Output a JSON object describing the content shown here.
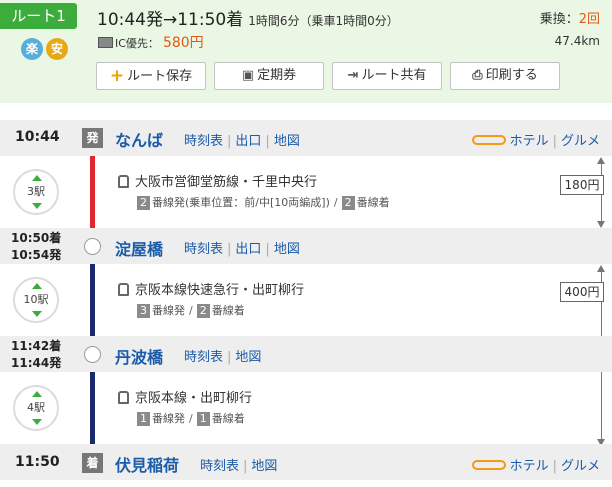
{
  "route": {
    "label": "ルート1",
    "badges": [
      "楽",
      "安"
    ],
    "times": "10:44発→11:50着",
    "duration": "1時間6分（乗車1時間0分）",
    "transfer_label": "乗換：",
    "transfer_count": "2回",
    "fare_mode": "IC優先：",
    "fare": "580円",
    "distance": "47.4km",
    "colors": {
      "accent": "#3cac3c",
      "fare": "#e05a10",
      "link": "#1b5ca8"
    }
  },
  "actions": {
    "save": "ルート保存",
    "pass": "定期券",
    "share": "ルート共有",
    "print": "印刷する"
  },
  "links": {
    "timetable": "時刻表",
    "exit": "出口",
    "map": "地図",
    "hotel": "ホテル",
    "gourmet": "グルメ"
  },
  "stations": [
    {
      "time": "10:44",
      "mark": "発",
      "name": "なんば"
    },
    {
      "arr": "10:50着",
      "dep": "10:54発",
      "name": "淀屋橋"
    },
    {
      "arr": "11:42着",
      "dep": "11:44発",
      "name": "丹波橋"
    },
    {
      "time": "11:50",
      "mark": "着",
      "name": "伏見稲荷"
    }
  ],
  "segments": [
    {
      "stops": "3駅",
      "line": "大阪市営御堂筋線・千里中央行",
      "dep_num": "2",
      "dep_text": "番線発(乗車位置：前/中[10両編成])",
      "arr_num": "2",
      "arr_text": "番線着",
      "fare": "180円",
      "rail_color": "#e0262f"
    },
    {
      "stops": "10駅",
      "line": "京阪本線快速急行・出町柳行",
      "dep_num": "3",
      "dep_text": "番線発",
      "arr_num": "2",
      "arr_text": "番線着",
      "fare": "400円",
      "rail_color": "#1a2a6c"
    },
    {
      "stops": "4駅",
      "line": "京阪本線・出町柳行",
      "dep_num": "1",
      "dep_text": "番線発",
      "arr_num": "1",
      "arr_text": "番線着"
    }
  ]
}
